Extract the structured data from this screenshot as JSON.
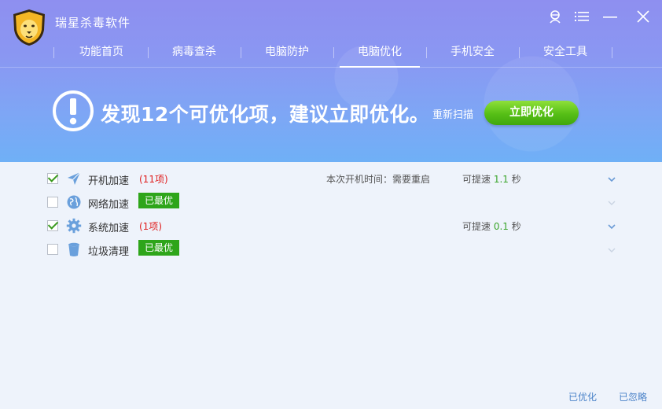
{
  "app": {
    "title": "瑞星杀毒软件"
  },
  "nav": {
    "items": [
      {
        "label": "功能首页"
      },
      {
        "label": "病毒查杀"
      },
      {
        "label": "电脑防护"
      },
      {
        "label": "电脑优化"
      },
      {
        "label": "手机安全"
      },
      {
        "label": "安全工具"
      }
    ],
    "active_index": 3
  },
  "banner": {
    "message": "发现12个可优化项，建议立即优化。",
    "rescan_label": "重新扫描",
    "optimize_label": "立即优化"
  },
  "items": [
    {
      "label": "开机加速",
      "checked": true,
      "count": "(11项)",
      "info": "本次开机时间：需要重启",
      "speed_prefix": "可提速 ",
      "speed_value": "1.1",
      "speed_unit": " 秒",
      "icon": "paper-plane-icon"
    },
    {
      "label": "网络加速",
      "checked": false,
      "badge": "已最优",
      "icon": "globe-icon"
    },
    {
      "label": "系统加速",
      "checked": true,
      "count": "(1项)",
      "speed_prefix": "可提速 ",
      "speed_value": "0.1",
      "speed_unit": " 秒",
      "icon": "gear-icon"
    },
    {
      "label": "垃圾清理",
      "checked": false,
      "badge": "已最优",
      "icon": "trash-bin-icon"
    }
  ],
  "footer": {
    "optimized_label": "已优化",
    "ignored_label": "已忽略"
  },
  "colors": {
    "accent_green": "#56bf16",
    "badge_green": "#2ea51a",
    "count_red": "#e0201f",
    "link_blue": "#4a82c8"
  }
}
